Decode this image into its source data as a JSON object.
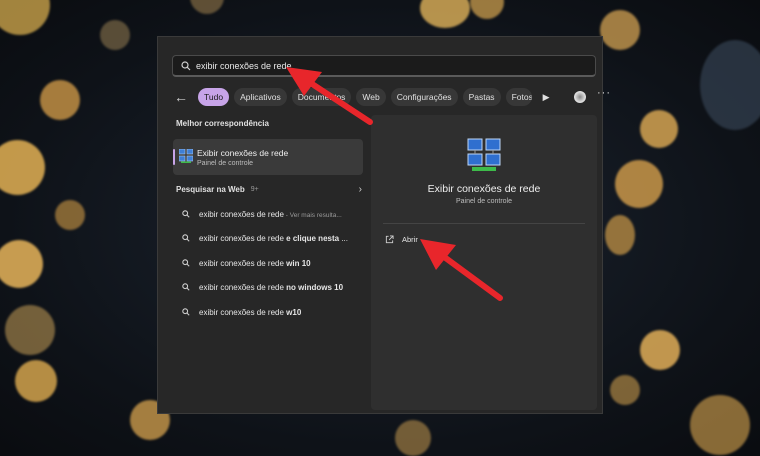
{
  "search": {
    "value": "exibir conexões de rede"
  },
  "filters": {
    "chips": [
      "Tudo",
      "Aplicativos",
      "Documentos",
      "Web",
      "Configurações",
      "Pastas",
      "Fotos"
    ]
  },
  "best_match": {
    "header": "Melhor correspondência",
    "title": "Exibir conexões de rede",
    "subtitle": "Painel de controle"
  },
  "web": {
    "header": "Pesquisar na Web",
    "count": "9+",
    "results": [
      {
        "prefix": "exibir conexões de rede",
        "bold": "",
        "extra": " - Ver mais resulta..."
      },
      {
        "prefix": "exibir conexões de rede ",
        "bold": "e clique nesta",
        "extra": " ..."
      },
      {
        "prefix": "exibir conexões de rede ",
        "bold": "win 10",
        "extra": ""
      },
      {
        "prefix": "exibir conexões de rede ",
        "bold": "no windows 10",
        "extra": ""
      },
      {
        "prefix": "exibir conexões de rede ",
        "bold": "w10",
        "extra": ""
      }
    ]
  },
  "detail": {
    "title": "Exibir conexões de rede",
    "subtitle": "Painel de controle",
    "action_label": "Abrir"
  },
  "colors": {
    "accent": "#c7a4e8",
    "annotation_arrow": "#e8262b"
  },
  "icons": {
    "search": "search-icon",
    "back": "back-arrow-icon",
    "play": "play-icon",
    "more": "more-icon",
    "open": "open-external-icon",
    "network": "network-connections-icon"
  }
}
